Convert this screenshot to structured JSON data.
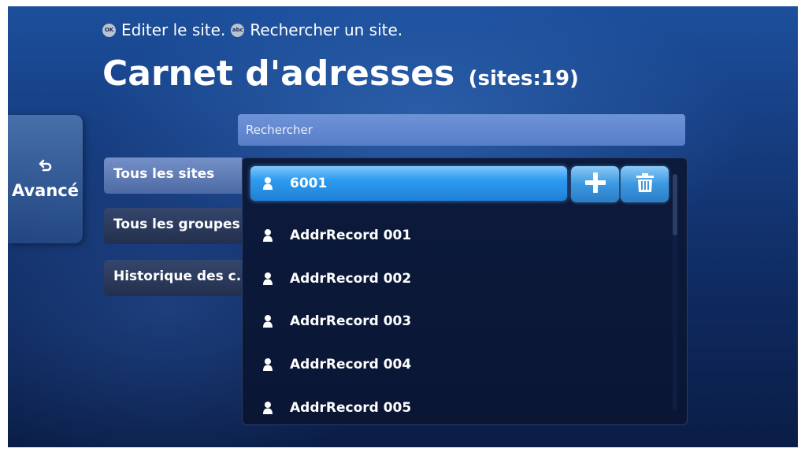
{
  "hints": {
    "ok_button": "OK",
    "ok_text": "Editer le site.",
    "abc_button": "abc",
    "abc_text": "Rechercher un site."
  },
  "header": {
    "title": "Carnet d'adresses",
    "count": "(sites:19)"
  },
  "back": {
    "icon": "return-arrow-icon",
    "label": "Avancé"
  },
  "search": {
    "placeholder": "Rechercher"
  },
  "tabs": [
    {
      "label": "Tous les sites",
      "active": true
    },
    {
      "label": "Tous les groupes",
      "active": false
    },
    {
      "label": "Historique des c...",
      "active": false
    }
  ],
  "list": {
    "items": [
      {
        "label": "6001",
        "selected": true
      },
      {
        "label": "AddrRecord 001"
      },
      {
        "label": "AddrRecord 002"
      },
      {
        "label": "AddrRecord 003"
      },
      {
        "label": "AddrRecord 004"
      },
      {
        "label": "AddrRecord 005"
      }
    ],
    "actions": [
      {
        "icon": "plus-icon"
      },
      {
        "icon": "trash-icon"
      }
    ]
  }
}
